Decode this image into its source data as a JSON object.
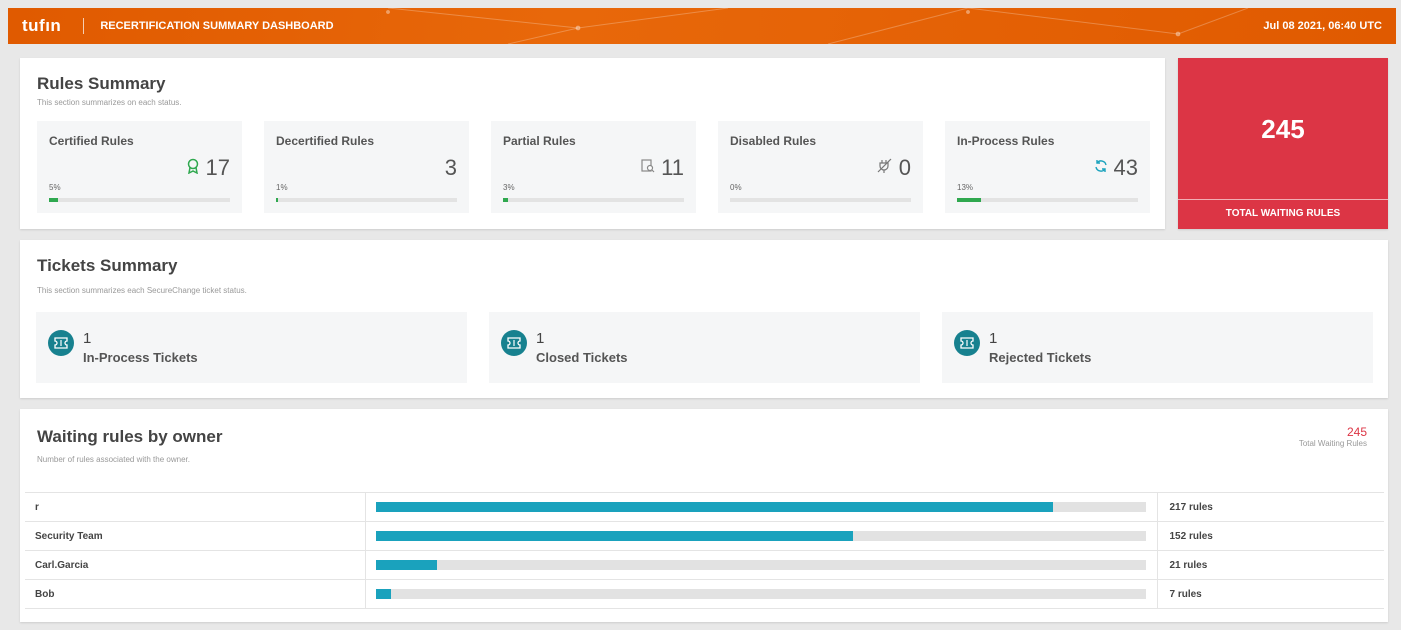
{
  "header": {
    "logo": "tufın",
    "title": "RECERTIFICATION SUMMARY DASHBOARD",
    "datetime": "Jul 08 2021, 06:40 UTC"
  },
  "rules_summary": {
    "title": "Rules Summary",
    "subtitle": "This section summarizes on each status.",
    "stats": [
      {
        "label": "Certified Rules",
        "value": "17",
        "percent": "5%",
        "fraction": 0.05,
        "icon": "ribbon-award-icon",
        "icon_color": "#2fa84f"
      },
      {
        "label": "Decertified Rules",
        "value": "3",
        "percent": "1%",
        "fraction": 0.01,
        "icon": "",
        "icon_color": ""
      },
      {
        "label": "Partial Rules",
        "value": "11",
        "percent": "3%",
        "fraction": 0.03,
        "icon": "document-search-icon",
        "icon_color": "#888888"
      },
      {
        "label": "Disabled Rules",
        "value": "0",
        "percent": "0%",
        "fraction": 0.0,
        "icon": "plug-off-icon",
        "icon_color": "#777777"
      },
      {
        "label": "In-Process Rules",
        "value": "43",
        "percent": "13%",
        "fraction": 0.13,
        "icon": "refresh-icon",
        "icon_color": "#1aa2bd"
      }
    ]
  },
  "total_waiting": {
    "value": "245",
    "label": "TOTAL WAITING RULES",
    "color": "#dc3545"
  },
  "tickets_summary": {
    "title": "Tickets Summary",
    "subtitle": "This section summarizes each SecureChange ticket status.",
    "tickets": [
      {
        "count": "1",
        "label": "In-Process Tickets",
        "icon": "ticket-icon"
      },
      {
        "count": "1",
        "label": "Closed Tickets",
        "icon": "ticket-icon"
      },
      {
        "count": "1",
        "label": "Rejected Tickets",
        "icon": "ticket-icon"
      }
    ]
  },
  "owners": {
    "title": "Waiting rules by owner",
    "subtitle": "Number of rules associated with the owner.",
    "total_value": "245",
    "total_label": "Total Waiting Rules",
    "rows": [
      {
        "owner": "r",
        "count": "217 rules",
        "fraction": 0.88
      },
      {
        "owner": "Security Team",
        "count": "152 rules",
        "fraction": 0.62
      },
      {
        "owner": "Carl.Garcia",
        "count": "21 rules",
        "fraction": 0.08
      },
      {
        "owner": "Bob",
        "count": "7 rules",
        "fraction": 0.02
      }
    ]
  },
  "colors": {
    "header": "#e05a00",
    "accent_teal": "#17818f",
    "bar_fill": "#1aa2bd",
    "progress_green": "#2fa84f"
  }
}
